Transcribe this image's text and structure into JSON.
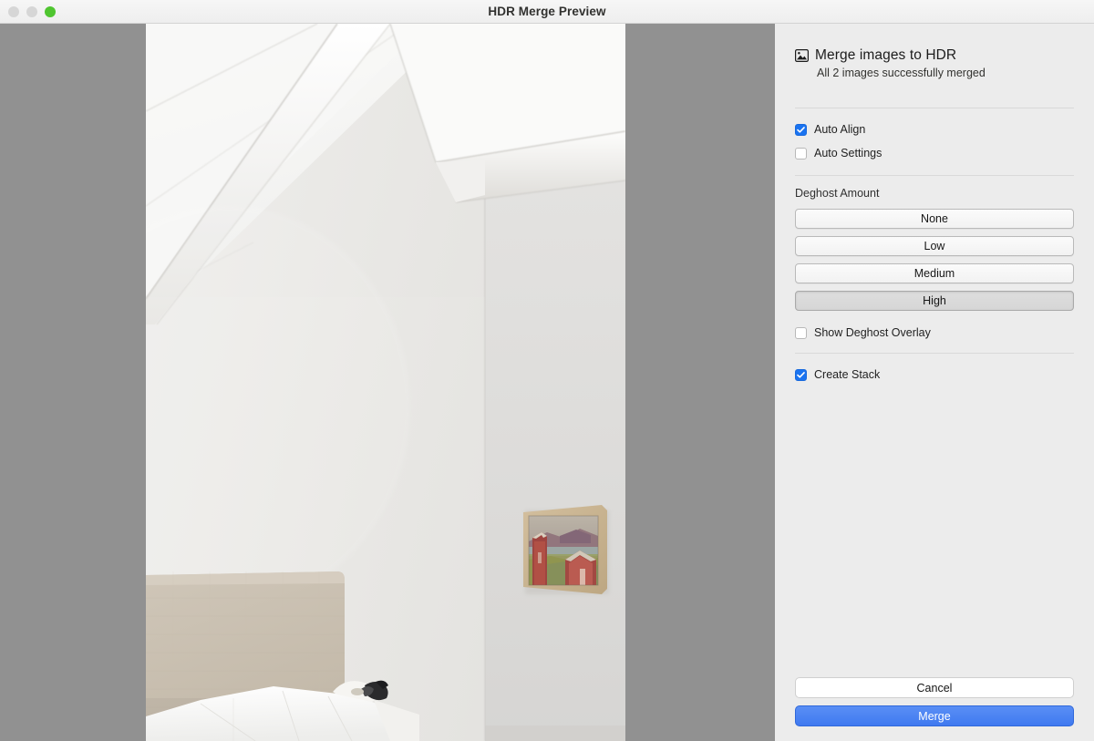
{
  "window": {
    "title": "HDR Merge Preview",
    "traffic_lights": [
      {
        "name": "close",
        "color": "#d6d6d6",
        "enabled": false
      },
      {
        "name": "minimize",
        "color": "#d6d6d6",
        "enabled": false
      },
      {
        "name": "zoom",
        "color": "#4fc530",
        "enabled": true
      }
    ]
  },
  "preview": {
    "backdrop_color": "#919191",
    "alt": "Bedroom interior with sloped white plank ceiling, beige linen headboard, white bedding and a small framed landscape painting on the wall"
  },
  "sidebar": {
    "header": {
      "icon": "picture-icon",
      "title": "Merge images to HDR",
      "subtitle": "All 2 images successfully merged"
    },
    "options": [
      {
        "name": "auto-align",
        "label": "Auto Align",
        "checked": true
      },
      {
        "name": "auto-settings",
        "label": "Auto Settings",
        "checked": false
      }
    ],
    "deghost": {
      "label": "Deghost Amount",
      "options": [
        "None",
        "Low",
        "Medium",
        "High"
      ],
      "selected": "High"
    },
    "overlay": {
      "name": "show-deghost-overlay",
      "label": "Show Deghost Overlay",
      "checked": false
    },
    "stack": {
      "name": "create-stack",
      "label": "Create Stack",
      "checked": true
    },
    "footer": {
      "cancel_label": "Cancel",
      "merge_label": "Merge",
      "merge_accent": "#3f79f0"
    }
  }
}
